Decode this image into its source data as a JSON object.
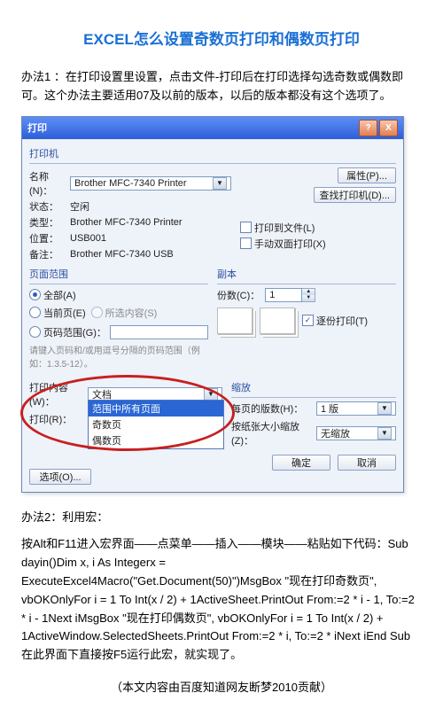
{
  "doc": {
    "title": "EXCEL怎么设置奇数页打印和偶数页打印",
    "method1": "办法1 ：在打印设置里设置，点击文件-打印后在打印选择勾选奇数或偶数即可。这个办法主要适用07及以前的版本，以后的版本都没有这个选项了。",
    "method2_label": "办法2：利用宏：",
    "method2_body": "按Alt和F11进入宏界面——点菜单——插入——模块——粘贴如下代码：Sub dayin()Dim x, i As Integerx = ExecuteExcel4Macro(\"Get.Document(50)\")MsgBox \"现在打印奇数页\", vbOKOnlyFor i = 1 To Int(x / 2) + 1ActiveSheet.PrintOut From:=2 * i - 1, To:=2 * i - 1Next iMsgBox \"现在打印偶数页\", vbOKOnlyFor i = 1 To Int(x / 2) + 1ActiveWindow.SelectedSheets.PrintOut From:=2 * i, To:=2 * iNext iEnd Sub在此界面下直接按F5运行此宏，就实现了。",
    "credit": "（本文内容由百度知道网友断梦2010贡献）"
  },
  "dlg": {
    "title": "打印",
    "help": "?",
    "close": "X",
    "groups": {
      "printer": "打印机",
      "range": "页面范围",
      "copies": "副本",
      "zoom": "缩放"
    },
    "printer": {
      "name_lbl": "名称(N)：",
      "name_val": "Brother MFC-7340 Printer",
      "status_lbl": "状态：",
      "status_val": "空闲",
      "type_lbl": "类型：",
      "type_val": "Brother MFC-7340 Printer",
      "port_lbl": "位置：",
      "port_val": "USB001",
      "comment_lbl": "备注：",
      "comment_val": "Brother MFC-7340 USB",
      "btn_props": "属性(P)...",
      "btn_find": "查找打印机(D)...",
      "chk_tofile": "打印到文件(L)",
      "chk_duplex": "手动双面打印(X)"
    },
    "range": {
      "all": "全部(A)",
      "current": "当前页(E)",
      "pages": "页码范围(G)：",
      "selected": "所选内容(S)",
      "hint": "请键入页码和/或用逗号分隔的页码范围（例如：1.3.5-12）。"
    },
    "copies": {
      "lbl": "份数(C)：",
      "val": "1",
      "collate": "逐份打印(T)"
    },
    "content": {
      "lbl": "打印内容(W)：",
      "val": "文档",
      "print_lbl": "打印(R)：",
      "print_val": "奇数页",
      "options": "选项(O)...",
      "dd1": "范围中所有页面",
      "dd2": "奇数页",
      "dd3": "偶数页"
    },
    "zoom": {
      "perpage_lbl": "每页的版数(H)：",
      "perpage_val": "1 版",
      "scale_lbl": "按纸张大小缩放(Z)：",
      "scale_val": "无缩放"
    },
    "btns": {
      "ok": "确定",
      "cancel": "取消"
    }
  }
}
